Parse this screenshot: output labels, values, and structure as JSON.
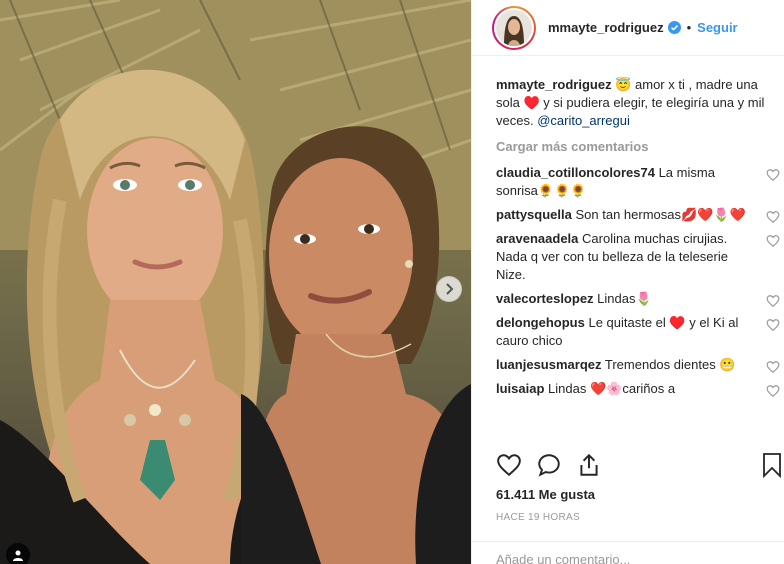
{
  "post": {
    "image_alt": "",
    "username": "mmayte_rodriguez",
    "follow_label": "Seguir",
    "separator": "•"
  },
  "caption": {
    "username": "mmayte_rodriguez",
    "text_before": "😇 amor x ti , madre una sola ♥️ y si pudiera elegir, te elegiría una y mil veces. ",
    "mention": "@carito_arregui"
  },
  "load_more_label": "Cargar más comentarios",
  "comments": [
    {
      "user": "claudia_cotilloncolores74",
      "text": "La misma sonrisa🌻🌻🌻"
    },
    {
      "user": "pattysquella",
      "text": "Son tan hermosas💋❤️🌷❤️"
    },
    {
      "user": "aravenaadela",
      "text": "Carolina muchas cirujias. Nada q ver con tu belleza de la teleserie Nize."
    },
    {
      "user": "valecorteslopez",
      "text": "Lindas🌷"
    },
    {
      "user": "delongehopus",
      "text": "Le quitaste el ♥️ y el Ki al cauro chico"
    },
    {
      "user": "luanjesusmarqez",
      "text": "Tremendos dientes 😬"
    },
    {
      "user": "luisaiap",
      "text": "Lindas ❤️🌸cariños a"
    }
  ],
  "likes_label": "61.411 Me gusta",
  "time_label": "HACE 19 HORAS",
  "add_comment_placeholder": "Añade un comentario...",
  "icons": {
    "like": "heart-outline-icon",
    "comment": "speech-bubble-icon",
    "share": "share-upload-icon",
    "save": "bookmark-icon",
    "verified": "verified-badge-icon",
    "next": "chevron-right-icon",
    "tag": "person-tag-icon"
  },
  "colors": {
    "link": "#3897f0",
    "verified": "#3897f0",
    "muted": "#999999",
    "text": "#262626",
    "border": "#efefef"
  }
}
